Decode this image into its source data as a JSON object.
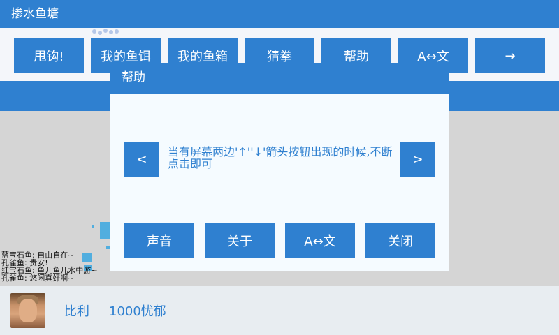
{
  "app": {
    "title": "掺水鱼塘"
  },
  "toolbar": {
    "buttons": [
      {
        "label": "甩钩!"
      },
      {
        "label": "我的鱼饵"
      },
      {
        "label": "我的鱼箱"
      },
      {
        "label": "猜拳"
      },
      {
        "label": "帮助"
      },
      {
        "label": "A↔文"
      },
      {
        "label": "→"
      }
    ]
  },
  "chat": {
    "lines": [
      "蓝宝石鱼: 自由自在~",
      "孔雀鱼: 贵安!",
      "红宝石鱼: 鱼儿鱼儿水中游~",
      "孔雀鱼: 悠闲真好啊~"
    ]
  },
  "player": {
    "name": "比利",
    "score": "1000忧郁"
  },
  "dialog": {
    "title": "帮助",
    "prev_label": "<",
    "next_label": ">",
    "text": "当有屏幕两边'↑''↓'箭头按钮出现的时候,不断点击即可",
    "buttons": {
      "sound": "声音",
      "about": "关于",
      "lang": "A↔文",
      "close": "关闭"
    }
  },
  "colors": {
    "accent": "#2f80d0",
    "background": "#d5d5d5",
    "dialog_body": "#f5fbff",
    "footer": "#e8edf1"
  }
}
